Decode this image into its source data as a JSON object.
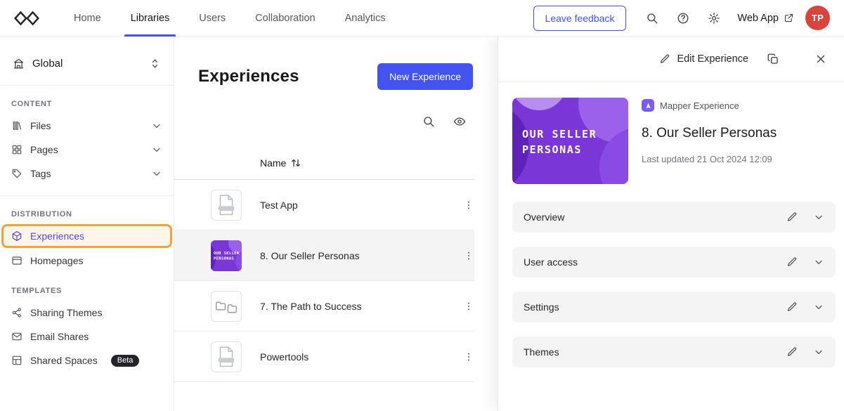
{
  "colors": {
    "accent": "#4353f0",
    "sidebar_active": "#4f46e5",
    "highlight_outline": "#f0a23c",
    "avatar_bg": "#d8453c",
    "cover_purple": "#7b36d8",
    "selected_row_bg": "#f4f4f5",
    "accordion_bg": "#f4f4f5",
    "beta_badge_bg": "#232329"
  },
  "icons": {
    "logo": "infinity-diamonds",
    "search": "magnifier",
    "help": "question-circle",
    "settings": "gear",
    "external_link": "arrow-out-of-box",
    "sort": "up-down-arrows",
    "preview": "eye",
    "edit": "pencil",
    "duplicate": "copy",
    "close": "x",
    "more": "kebab-vertical"
  },
  "topnav": {
    "items": [
      {
        "label": "Home",
        "active": false
      },
      {
        "label": "Libraries",
        "active": true
      },
      {
        "label": "Users",
        "active": false
      },
      {
        "label": "Collaboration",
        "active": false
      },
      {
        "label": "Analytics",
        "active": false
      }
    ],
    "feedback_button": "Leave feedback",
    "webapp_label": "Web App",
    "avatar": "TP"
  },
  "sidebar": {
    "scope": {
      "label": "Global"
    },
    "sections": [
      {
        "title": "CONTENT",
        "items": [
          {
            "label": "Files"
          },
          {
            "label": "Pages"
          },
          {
            "label": "Tags"
          }
        ]
      },
      {
        "title": "DISTRIBUTION",
        "items": [
          {
            "label": "Experiences",
            "active": true,
            "highlighted": true
          },
          {
            "label": "Homepages"
          }
        ]
      },
      {
        "title": "TEMPLATES",
        "items": [
          {
            "label": "Sharing Themes"
          },
          {
            "label": "Email Shares"
          },
          {
            "label": "Shared Spaces",
            "badge": "Beta"
          }
        ]
      }
    ]
  },
  "main": {
    "title": "Experiences",
    "new_button": "New Experience",
    "table": {
      "columns": [
        {
          "label": "Name",
          "sortable": true
        }
      ],
      "rows": [
        {
          "name": "Test App",
          "thumb": "document",
          "selected": false
        },
        {
          "name": "8. Our Seller Personas",
          "thumb": "cover",
          "selected": true
        },
        {
          "name": "7. The Path to Success",
          "thumb": "folders",
          "selected": false
        },
        {
          "name": "Powertools",
          "thumb": "document",
          "selected": false
        }
      ]
    }
  },
  "panel": {
    "edit_button": "Edit Experience",
    "type_badge": "Mapper Experience",
    "title": "8. Our Seller Personas",
    "last_updated": "Last updated 21 Oct 2024 12:09",
    "cover": {
      "line1": "OUR SELLER",
      "line2": "PERSONAS"
    },
    "sections": [
      {
        "label": "Overview"
      },
      {
        "label": "User access"
      },
      {
        "label": "Settings"
      },
      {
        "label": "Themes"
      }
    ]
  }
}
